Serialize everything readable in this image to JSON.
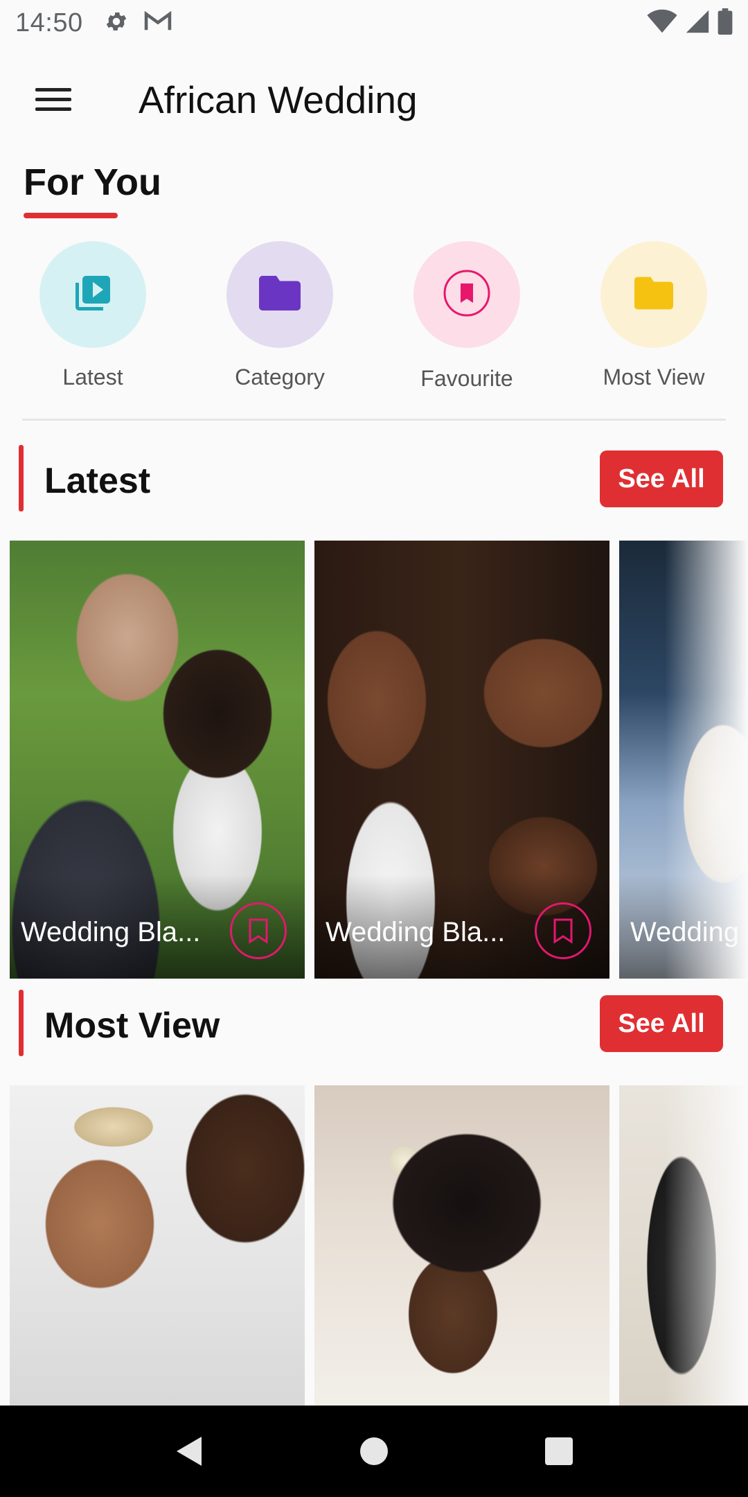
{
  "status_bar": {
    "time": "14:50",
    "left_icons": [
      "gear-icon",
      "gmail-icon"
    ],
    "right_icons": [
      "wifi-icon",
      "signal-icon",
      "battery-icon"
    ]
  },
  "app_bar": {
    "title": "African Wedding",
    "menu_icon": "hamburger-menu-icon"
  },
  "for_you": {
    "title": "For You",
    "items": [
      {
        "label": "Latest",
        "icon": "video-library-icon",
        "bg": "#d6f1f3",
        "fg": "#1ea6b8"
      },
      {
        "label": "Category",
        "icon": "folder-icon",
        "bg": "#e3dbef",
        "fg": "#6b35c4"
      },
      {
        "label": "Favourite",
        "icon": "bookmark-icon",
        "bg": "#fcdde8",
        "fg": "#e8176b"
      },
      {
        "label": "Most View",
        "icon": "folder-icon",
        "bg": "#fdf1d3",
        "fg": "#f5c211"
      }
    ]
  },
  "sections": {
    "latest": {
      "title": "Latest",
      "see_all": "See All",
      "cards": [
        {
          "title": "Wedding Bla...",
          "bookmark": true
        },
        {
          "title": "Wedding Bla...",
          "bookmark": true
        },
        {
          "title": "Wedding ",
          "bookmark": false
        }
      ]
    },
    "most_view": {
      "title": "Most View",
      "see_all": "See All",
      "cards": [
        {
          "title": ""
        },
        {
          "title": ""
        },
        {
          "title": ""
        }
      ]
    }
  },
  "colors": {
    "accent": "#e02f33",
    "bookmark": "#e3186e",
    "background": "#fafafa"
  },
  "nav_bar": {
    "buttons": [
      "back-icon",
      "home-icon",
      "recents-icon"
    ]
  }
}
